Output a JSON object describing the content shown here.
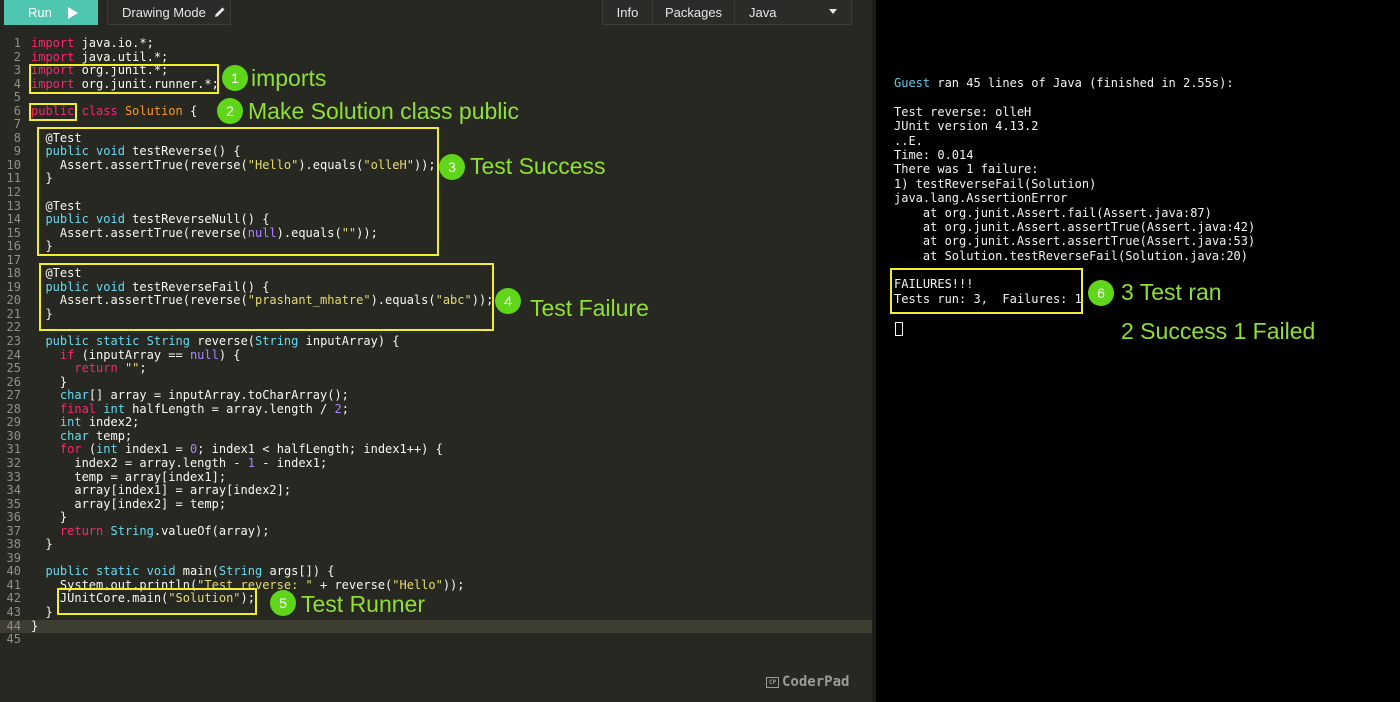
{
  "toolbar": {
    "run_label": "Run",
    "drawing_mode_label": "Drawing Mode",
    "info_label": "Info",
    "packages_label": "Packages",
    "language_label": "Java"
  },
  "colors": {
    "run_button": "#4fc7b0",
    "annotation_box": "#f2ee2c",
    "annotation_text": "#8fe030",
    "badge": "#5fd61a"
  },
  "code_lines": [
    [
      {
        "t": "k",
        "v": "import"
      },
      {
        "t": "a",
        "v": " java.io.*;"
      }
    ],
    [
      {
        "t": "k",
        "v": "import"
      },
      {
        "t": "a",
        "v": " java.util.*;"
      }
    ],
    [
      {
        "t": "k",
        "v": "import"
      },
      {
        "t": "a",
        "v": " org.junit.*;"
      }
    ],
    [
      {
        "t": "k",
        "v": "import"
      },
      {
        "t": "a",
        "v": " org.junit.runner.*;"
      }
    ],
    [],
    [
      {
        "t": "k",
        "v": "public"
      },
      {
        "t": "a",
        "v": " "
      },
      {
        "t": "k",
        "v": "class"
      },
      {
        "t": "a",
        "v": " "
      },
      {
        "t": "c",
        "v": "Solution"
      },
      {
        "t": "a",
        "v": " {"
      }
    ],
    [],
    [
      {
        "t": "a",
        "v": "  @Test"
      }
    ],
    [
      {
        "t": "a",
        "v": "  "
      },
      {
        "t": "t",
        "v": "public"
      },
      {
        "t": "a",
        "v": " "
      },
      {
        "t": "t",
        "v": "void"
      },
      {
        "t": "a",
        "v": " testReverse() {"
      }
    ],
    [
      {
        "t": "a",
        "v": "    Assert.assertTrue(reverse("
      },
      {
        "t": "s",
        "v": "\"Hello\""
      },
      {
        "t": "a",
        "v": ").equals("
      },
      {
        "t": "s",
        "v": "\"olleH\""
      },
      {
        "t": "a",
        "v": "));"
      }
    ],
    [
      {
        "t": "a",
        "v": "  }"
      }
    ],
    [],
    [
      {
        "t": "a",
        "v": "  @Test"
      }
    ],
    [
      {
        "t": "a",
        "v": "  "
      },
      {
        "t": "t",
        "v": "public"
      },
      {
        "t": "a",
        "v": " "
      },
      {
        "t": "t",
        "v": "void"
      },
      {
        "t": "a",
        "v": " testReverseNull() {"
      }
    ],
    [
      {
        "t": "a",
        "v": "    Assert.assertTrue(reverse("
      },
      {
        "t": "n",
        "v": "null"
      },
      {
        "t": "a",
        "v": ").equals("
      },
      {
        "t": "s",
        "v": "\"\""
      },
      {
        "t": "a",
        "v": "));"
      }
    ],
    [
      {
        "t": "a",
        "v": "  }"
      }
    ],
    [],
    [
      {
        "t": "a",
        "v": "  @Test"
      }
    ],
    [
      {
        "t": "a",
        "v": "  "
      },
      {
        "t": "t",
        "v": "public"
      },
      {
        "t": "a",
        "v": " "
      },
      {
        "t": "t",
        "v": "void"
      },
      {
        "t": "a",
        "v": " testReverseFail() {"
      }
    ],
    [
      {
        "t": "a",
        "v": "    Assert.assertTrue(reverse("
      },
      {
        "t": "s",
        "v": "\"prashant_mhatre\""
      },
      {
        "t": "a",
        "v": ").equals("
      },
      {
        "t": "s",
        "v": "\"abc\""
      },
      {
        "t": "a",
        "v": "));"
      }
    ],
    [
      {
        "t": "a",
        "v": "  }"
      }
    ],
    [],
    [
      {
        "t": "a",
        "v": "  "
      },
      {
        "t": "t",
        "v": "public"
      },
      {
        "t": "a",
        "v": " "
      },
      {
        "t": "t",
        "v": "static"
      },
      {
        "t": "a",
        "v": " "
      },
      {
        "t": "t",
        "v": "String"
      },
      {
        "t": "a",
        "v": " reverse("
      },
      {
        "t": "t",
        "v": "String"
      },
      {
        "t": "a",
        "v": " inputArray) {"
      }
    ],
    [
      {
        "t": "a",
        "v": "    "
      },
      {
        "t": "k",
        "v": "if"
      },
      {
        "t": "a",
        "v": " (inputArray == "
      },
      {
        "t": "n",
        "v": "null"
      },
      {
        "t": "a",
        "v": ") {"
      }
    ],
    [
      {
        "t": "a",
        "v": "      "
      },
      {
        "t": "k",
        "v": "return"
      },
      {
        "t": "a",
        "v": " "
      },
      {
        "t": "s",
        "v": "\"\""
      },
      {
        "t": "a",
        "v": ";"
      }
    ],
    [
      {
        "t": "a",
        "v": "    }"
      }
    ],
    [
      {
        "t": "a",
        "v": "    "
      },
      {
        "t": "t",
        "v": "char"
      },
      {
        "t": "a",
        "v": "[] array = inputArray.toCharArray();"
      }
    ],
    [
      {
        "t": "a",
        "v": "    "
      },
      {
        "t": "k",
        "v": "final"
      },
      {
        "t": "a",
        "v": " "
      },
      {
        "t": "t",
        "v": "int"
      },
      {
        "t": "a",
        "v": " halfLength = array.length / "
      },
      {
        "t": "n",
        "v": "2"
      },
      {
        "t": "a",
        "v": ";"
      }
    ],
    [
      {
        "t": "a",
        "v": "    "
      },
      {
        "t": "t",
        "v": "int"
      },
      {
        "t": "a",
        "v": " index2;"
      }
    ],
    [
      {
        "t": "a",
        "v": "    "
      },
      {
        "t": "t",
        "v": "char"
      },
      {
        "t": "a",
        "v": " temp;"
      }
    ],
    [
      {
        "t": "a",
        "v": "    "
      },
      {
        "t": "k",
        "v": "for"
      },
      {
        "t": "a",
        "v": " ("
      },
      {
        "t": "t",
        "v": "int"
      },
      {
        "t": "a",
        "v": " index1 = "
      },
      {
        "t": "n",
        "v": "0"
      },
      {
        "t": "a",
        "v": "; index1 < halfLength; index1++) {"
      }
    ],
    [
      {
        "t": "a",
        "v": "      index2 = array.length - "
      },
      {
        "t": "n",
        "v": "1"
      },
      {
        "t": "a",
        "v": " - index1;"
      }
    ],
    [
      {
        "t": "a",
        "v": "      temp = array[index1];"
      }
    ],
    [
      {
        "t": "a",
        "v": "      array[index1] = array[index2];"
      }
    ],
    [
      {
        "t": "a",
        "v": "      array[index2] = temp;"
      }
    ],
    [
      {
        "t": "a",
        "v": "    }"
      }
    ],
    [
      {
        "t": "a",
        "v": "    "
      },
      {
        "t": "k",
        "v": "return"
      },
      {
        "t": "a",
        "v": " "
      },
      {
        "t": "t",
        "v": "String"
      },
      {
        "t": "a",
        "v": ".valueOf(array);"
      }
    ],
    [
      {
        "t": "a",
        "v": "  }"
      }
    ],
    [],
    [
      {
        "t": "a",
        "v": "  "
      },
      {
        "t": "t",
        "v": "public"
      },
      {
        "t": "a",
        "v": " "
      },
      {
        "t": "t",
        "v": "static"
      },
      {
        "t": "a",
        "v": " "
      },
      {
        "t": "t",
        "v": "void"
      },
      {
        "t": "a",
        "v": " main("
      },
      {
        "t": "t",
        "v": "String"
      },
      {
        "t": "a",
        "v": " args[]) {"
      }
    ],
    [
      {
        "t": "a",
        "v": "    System.out.println("
      },
      {
        "t": "s",
        "v": "\"Test reverse: \""
      },
      {
        "t": "a",
        "v": " + reverse("
      },
      {
        "t": "s",
        "v": "\"Hello\""
      },
      {
        "t": "a",
        "v": "));"
      }
    ],
    [
      {
        "t": "a",
        "v": "    JUnitCore.main("
      },
      {
        "t": "s",
        "v": "\"Solution\""
      },
      {
        "t": "a",
        "v": ");"
      }
    ],
    [
      {
        "t": "a",
        "v": "  }"
      }
    ],
    [
      {
        "t": "a",
        "v": "}"
      }
    ],
    []
  ],
  "annotations": [
    {
      "badge": "1",
      "label": "imports"
    },
    {
      "badge": "2",
      "label": "Make Solution class public"
    },
    {
      "badge": "3",
      "label": "Test Success"
    },
    {
      "badge": "4",
      "label": "Test Failure"
    },
    {
      "badge": "5",
      "label": "Test Runner"
    },
    {
      "badge": "6",
      "label": "3 Test ran"
    },
    {
      "label": "2 Success 1 Failed"
    }
  ],
  "console": {
    "guest": "Guest",
    "header_rest": " ran 45 lines of Java (finished in 2.55s):",
    "lines": [
      "",
      "Test reverse: olleH",
      "JUnit version 4.13.2",
      "..E.",
      "Time: 0.014",
      "There was 1 failure:",
      "1) testReverseFail(Solution)",
      "java.lang.AssertionError",
      "    at org.junit.Assert.fail(Assert.java:87)",
      "    at org.junit.Assert.assertTrue(Assert.java:42)",
      "    at org.junit.Assert.assertTrue(Assert.java:53)",
      "    at Solution.testReverseFail(Solution.java:20)",
      "",
      "FAILURES!!!",
      "Tests run: 3,  Failures: 1"
    ]
  },
  "watermark": {
    "logo": "CP",
    "text": "CoderPad"
  }
}
